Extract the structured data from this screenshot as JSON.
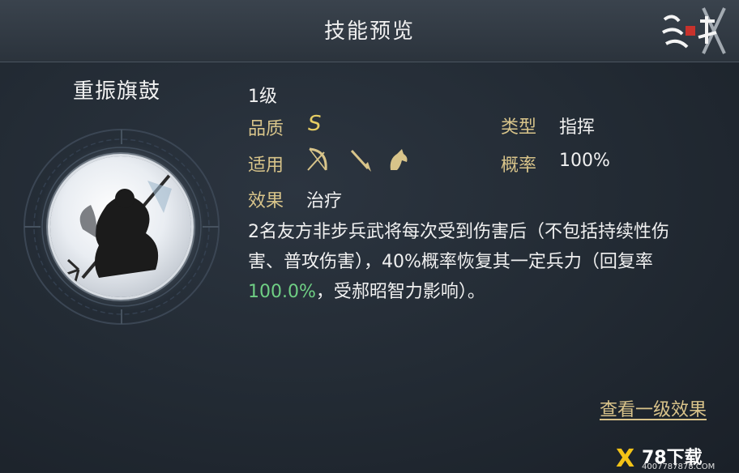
{
  "header": {
    "title": "技能预览",
    "logo_icon": "game-logo-icon"
  },
  "skill": {
    "name": "重振旗鼓",
    "level": "1级",
    "quality_label": "品质",
    "quality_value": "S",
    "type_label": "类型",
    "type_value": "指挥",
    "applicable_label": "适用",
    "applicable_icons": [
      "bow-icon",
      "spear-icon",
      "horse-icon"
    ],
    "probability_label": "概率",
    "probability_value": "100%",
    "effect_label": "效果",
    "effect_value": "治疗",
    "description_part1": "2名友方非步兵武将每次受到伤害后（不包括持续性伤害、普攻伤害），40%概率恢复其一定兵力（回复率",
    "description_highlight": "100.0%",
    "description_part2": "，受郝昭智力影响）。"
  },
  "actions": {
    "view_level1": "查看一级效果"
  },
  "watermark": {
    "text": "78下载",
    "subtext": "4007787878.COM"
  },
  "colors": {
    "label": "#d8c48a",
    "grade": "#e6cd63",
    "highlight": "#6fcf84",
    "background": "#1f262e"
  }
}
